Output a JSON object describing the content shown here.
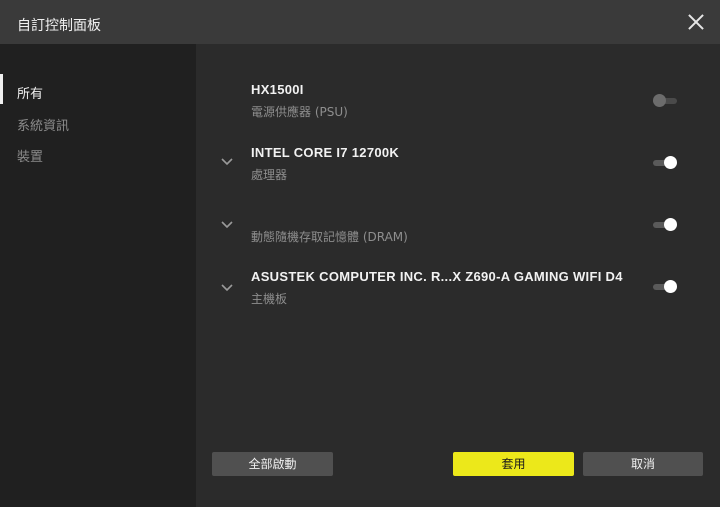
{
  "window": {
    "title": "自訂控制面板"
  },
  "sidebar": {
    "items": [
      {
        "label": "所有",
        "active": true
      },
      {
        "label": "系統資訊",
        "active": false
      },
      {
        "label": "裝置",
        "active": false
      }
    ]
  },
  "devices": [
    {
      "name": "HX1500I",
      "type": "電源供應器 (PSU)",
      "expandable": false,
      "enabled": false
    },
    {
      "name": "INTEL CORE I7 12700K",
      "type": "處理器",
      "expandable": true,
      "enabled": true
    },
    {
      "name": "",
      "type": "動態隨機存取記憶體 (DRAM)",
      "expandable": true,
      "enabled": true
    },
    {
      "name": "ASUSTEK COMPUTER INC. R...X Z690-A GAMING WIFI D4",
      "type": "主機板",
      "expandable": true,
      "enabled": true
    }
  ],
  "footer": {
    "enable_all_label": "全部啟動",
    "apply_label": "套用",
    "cancel_label": "取消"
  },
  "colors": {
    "accent": "#ece81a",
    "titlebar": "#3a3a3a",
    "sidebar": "#202020",
    "main": "#2b2b2b"
  }
}
